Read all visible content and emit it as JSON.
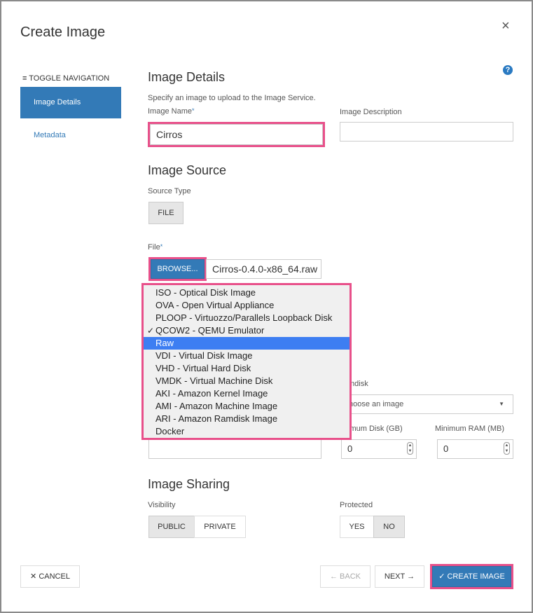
{
  "modal": {
    "title": "Create Image",
    "close_icon": "×",
    "help_icon": "?"
  },
  "nav": {
    "toggle_label": "≡ TOGGLE NAVIGATION",
    "items": [
      {
        "label": "Image Details",
        "active": true
      },
      {
        "label": "Metadata",
        "active": false
      }
    ]
  },
  "details": {
    "heading": "Image Details",
    "subtitle": "Specify an image to upload to the Image Service.",
    "name_label": "Image Name",
    "required_mark": "*",
    "name_value": "Cirros",
    "desc_label": "Image Description",
    "desc_value": ""
  },
  "source": {
    "heading": "Image Source",
    "type_label": "Source Type",
    "type_button": "FILE",
    "file_label": "File",
    "browse_button": "BROWSE...",
    "file_name": "Cirros-0.4.0-x86_64.raw"
  },
  "format_dropdown": {
    "options": [
      {
        "label": "ISO - Optical Disk Image",
        "checked": false,
        "selected": false
      },
      {
        "label": "OVA - Open Virtual Appliance",
        "checked": false,
        "selected": false
      },
      {
        "label": "PLOOP - Virtuozzo/Parallels Loopback Disk",
        "checked": false,
        "selected": false
      },
      {
        "label": "QCOW2 - QEMU Emulator",
        "checked": true,
        "selected": false
      },
      {
        "label": "Raw",
        "checked": false,
        "selected": true
      },
      {
        "label": "VDI - Virtual Disk Image",
        "checked": false,
        "selected": false
      },
      {
        "label": "VHD - Virtual Hard Disk",
        "checked": false,
        "selected": false
      },
      {
        "label": "VMDK - Virtual Machine Disk",
        "checked": false,
        "selected": false
      },
      {
        "label": "AKI - Amazon Kernel Image",
        "checked": false,
        "selected": false
      },
      {
        "label": "AMI - Amazon Machine Image",
        "checked": false,
        "selected": false
      },
      {
        "label": "ARI - Amazon Ramdisk Image",
        "checked": false,
        "selected": false
      },
      {
        "label": "Docker",
        "checked": false,
        "selected": false
      }
    ],
    "check_glyph": "✓"
  },
  "requirements": {
    "ramdisk_label_partial": "mdisk",
    "ramdisk_placeholder_partial": "hoose an image",
    "min_disk_label_partial": "imum Disk (GB)",
    "min_disk_value": "0",
    "min_ram_label": "Minimum RAM (MB)",
    "min_ram_value": "0",
    "spinner_up": "▲",
    "spinner_down": "▼",
    "select_caret": "▼"
  },
  "sharing": {
    "heading": "Image Sharing",
    "visibility_label": "Visibility",
    "visibility_options": [
      "PUBLIC",
      "PRIVATE"
    ],
    "visibility_selected": "PUBLIC",
    "protected_label": "Protected",
    "protected_options": [
      "YES",
      "NO"
    ],
    "protected_selected": "NO"
  },
  "footer": {
    "cancel": "✕ CANCEL",
    "back": "← BACK",
    "next": "NEXT →",
    "create": "✓ CREATE IMAGE"
  },
  "colors": {
    "primary": "#337ab7",
    "highlight": "#e8508a",
    "dropdown_selected": "#3d7ef2"
  }
}
